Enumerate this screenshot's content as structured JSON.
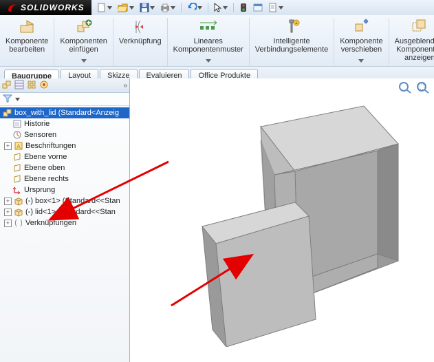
{
  "app": {
    "name": "SOLIDWORKS"
  },
  "ribbon": [
    {
      "label": "Komponente\nbearbeiten"
    },
    {
      "label": "Komponenten\neinfügen"
    },
    {
      "label": "Verknüpfung"
    },
    {
      "label": "Lineares\nKomponentenmuster"
    },
    {
      "label": "Intelligente\nVerbindungselemente"
    },
    {
      "label": "Komponente\nverschieben"
    },
    {
      "label": "Ausgeblendete\nKomponenten\nanzeigen"
    }
  ],
  "tabs": [
    {
      "label": "Baugruppe",
      "active": true
    },
    {
      "label": "Layout"
    },
    {
      "label": "Skizze"
    },
    {
      "label": "Evaluieren"
    },
    {
      "label": "Office Produkte"
    }
  ],
  "tree": {
    "root": "box_with_lid  (Standard<Anzeig",
    "items": [
      {
        "label": "Historie"
      },
      {
        "label": "Sensoren"
      },
      {
        "label": "Beschriftungen",
        "expandable": true
      },
      {
        "label": "Ebene vorne"
      },
      {
        "label": "Ebene oben"
      },
      {
        "label": "Ebene rechts"
      },
      {
        "label": "Ursprung"
      },
      {
        "label": "(-) box<1> (Standard<<Stan",
        "expandable": true
      },
      {
        "label": "(-) lid<1> (Standard<<Stan",
        "expandable": true
      },
      {
        "label": "Verknüpfungen",
        "expandable": true
      }
    ]
  },
  "colors": {
    "arrow": "#e30000",
    "selection": "#1e66c8",
    "model_light": "#d7d7d7",
    "model_mid": "#bdbdbd",
    "model_dark": "#9a9a9a",
    "model_inner": "#a8a8a8"
  }
}
